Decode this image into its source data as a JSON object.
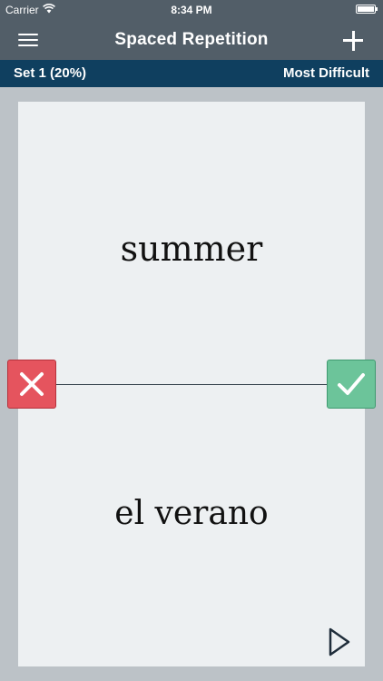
{
  "status_bar": {
    "carrier": "Carrier",
    "time": "8:34 PM",
    "wifi_icon": "wifi-icon",
    "battery_icon": "battery-icon"
  },
  "nav": {
    "title": "Spaced Repetition",
    "menu_icon": "hamburger-menu-icon",
    "add_icon": "plus-icon"
  },
  "set_bar": {
    "set_label": "Set 1 (20%)",
    "difficulty_label": "Most Difficult"
  },
  "card": {
    "term": "summer",
    "definition": "el verano"
  },
  "actions": {
    "wrong_icon": "x-icon",
    "right_icon": "checkmark-icon",
    "play_icon": "play-icon"
  },
  "colors": {
    "nav_background": "#525e68",
    "set_bar_background": "#0f3f5f",
    "card_background": "#edf0f2",
    "page_background": "#bcc2c7",
    "wrong_red": "#e5545e",
    "right_green": "#6cc49a"
  }
}
